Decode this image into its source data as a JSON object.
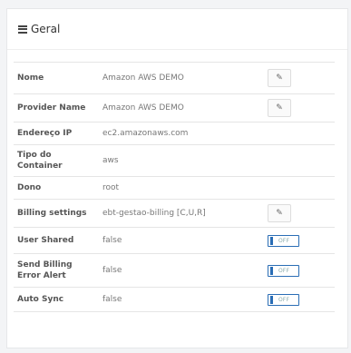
{
  "panel": {
    "title": "Geral"
  },
  "rows": [
    {
      "label": "Nome",
      "value": "Amazon AWS DEMO",
      "action": "edit"
    },
    {
      "label": "Provider Name",
      "value": "Amazon AWS DEMO",
      "action": "edit"
    },
    {
      "label": "Endereço IP",
      "value": "ec2.amazonaws.com",
      "action": "none"
    },
    {
      "label": "Tipo do Container",
      "value": "aws",
      "action": "none"
    },
    {
      "label": "Dono",
      "value": "root",
      "action": "none"
    },
    {
      "label": "Billing settings",
      "value": "ebt-gestao-billing [C,U,R]",
      "action": "edit"
    },
    {
      "label": "User Shared",
      "value": "false",
      "action": "toggle",
      "toggle_text": "OFF"
    },
    {
      "label": "Send Billing Error Alert",
      "value": "false",
      "action": "toggle",
      "toggle_text": "OFF"
    },
    {
      "label": "Auto Sync",
      "value": "false",
      "action": "toggle",
      "toggle_text": "OFF"
    }
  ],
  "colors": {
    "toggle_border": "#2a6db5"
  },
  "icons": {
    "header": "list-icon",
    "edit": "edit-icon"
  }
}
